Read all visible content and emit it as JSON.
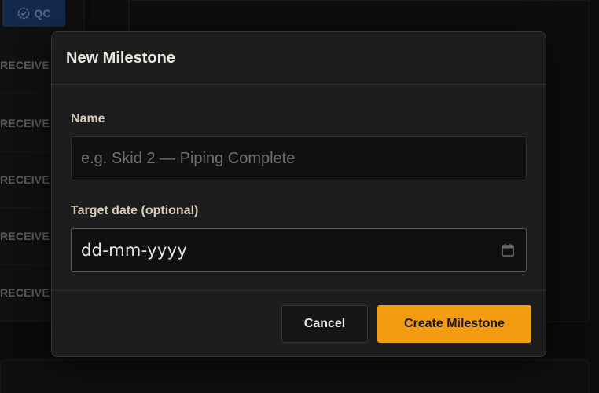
{
  "background": {
    "qc_label": "QC",
    "rows": [
      "RECEIVE",
      "RECEIVE",
      "RECEIVE",
      "RECEIVE",
      "RECEIVE"
    ]
  },
  "modal": {
    "title": "New Milestone",
    "name_label": "Name",
    "name_placeholder": "e.g. Skid 2 — Piping Complete",
    "name_value": "",
    "date_label": "Target date (optional)",
    "date_value": "dd-mm-yyyy",
    "cancel_label": "Cancel",
    "create_label": "Create Milestone"
  },
  "colors": {
    "accent": "#f39c12",
    "qc_badge": "#1e3f78"
  },
  "icons": {
    "qc": "check-badge-icon",
    "date": "calendar-icon"
  }
}
